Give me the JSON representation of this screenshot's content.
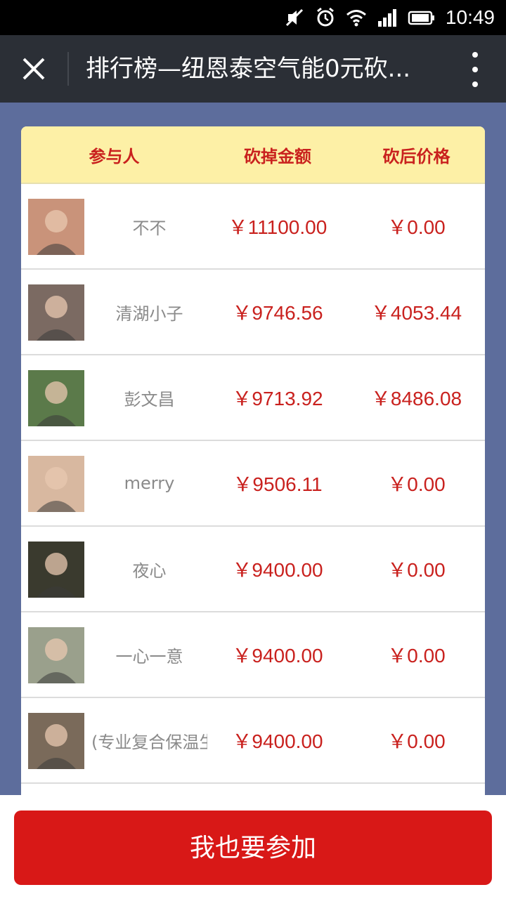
{
  "status_bar": {
    "time": "10:49",
    "icons": [
      "mute-icon",
      "alarm-icon",
      "wifi-icon",
      "signal-icon",
      "battery-icon"
    ]
  },
  "title_bar": {
    "title": "排行榜—纽恩泰空气能0元砍...",
    "close_icon": "close-icon",
    "more_icon": "more-vertical-icon"
  },
  "table": {
    "headers": {
      "participant": "参与人",
      "cut_amount": "砍掉金额",
      "price_after": "砍后价格"
    },
    "rows": [
      {
        "name": "不不",
        "cut": "￥11100.00",
        "after": "￥0.00",
        "avatar_color": "#c9937a"
      },
      {
        "name": "清湖小子",
        "cut": "￥9746.56",
        "after": "￥4053.44",
        "avatar_color": "#7b6a62"
      },
      {
        "name": "彭文昌",
        "cut": "￥9713.92",
        "after": "￥8486.08",
        "avatar_color": "#5b7a4a"
      },
      {
        "name": "merry",
        "cut": "￥9506.11",
        "after": "￥0.00",
        "avatar_color": "#d8b8a0"
      },
      {
        "name": "夜心",
        "cut": "￥9400.00",
        "after": "￥0.00",
        "avatar_color": "#3a3a2e"
      },
      {
        "name": "一心一意",
        "cut": "￥9400.00",
        "after": "￥0.00",
        "avatar_color": "#9aa08c"
      },
      {
        "name": "(专业复合保温生",
        "cut": "￥9400.00",
        "after": "￥0.00",
        "avatar_color": "#7a6a5a"
      }
    ]
  },
  "footer": {
    "join_label": "我也要参加"
  },
  "colors": {
    "accent_red": "#c9211e",
    "button_red": "#d81817",
    "header_yellow": "#fdf0a6",
    "background": "#5d6d9c",
    "title_bar": "#2b2f36"
  }
}
